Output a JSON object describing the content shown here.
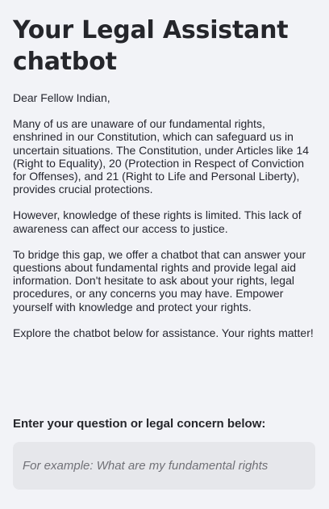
{
  "header": {
    "title": "Your Legal Assistant chatbot"
  },
  "intro": {
    "greeting": "Dear Fellow Indian,",
    "paragraph1": "Many of us are unaware of our fundamental rights, enshrined in our Constitution, which can safeguard us in uncertain situations. The Constitution, under Articles like 14 (Right to Equality), 20 (Protection in Respect of Conviction for Offenses), and 21 (Right to Life and Personal Liberty), provides crucial protections.",
    "paragraph2": "However, knowledge of these rights is limited. This lack of awareness can affect our access to justice.",
    "paragraph3": "To bridge this gap, we offer a chatbot that can answer your questions about fundamental rights and provide legal aid information. Don't hesitate to ask about your rights, legal procedures, or any concerns you may have. Empower yourself with knowledge and protect your rights.",
    "paragraph4": "Explore the chatbot below for assistance. Your rights matter!"
  },
  "question_input": {
    "label": "Enter your question or legal concern below:",
    "placeholder": "For example: What are my fundamental rights",
    "value": ""
  },
  "colors": {
    "background": "#f2f3f7",
    "text": "#262730",
    "input_background": "#e6e7eb",
    "placeholder": "#717177"
  }
}
